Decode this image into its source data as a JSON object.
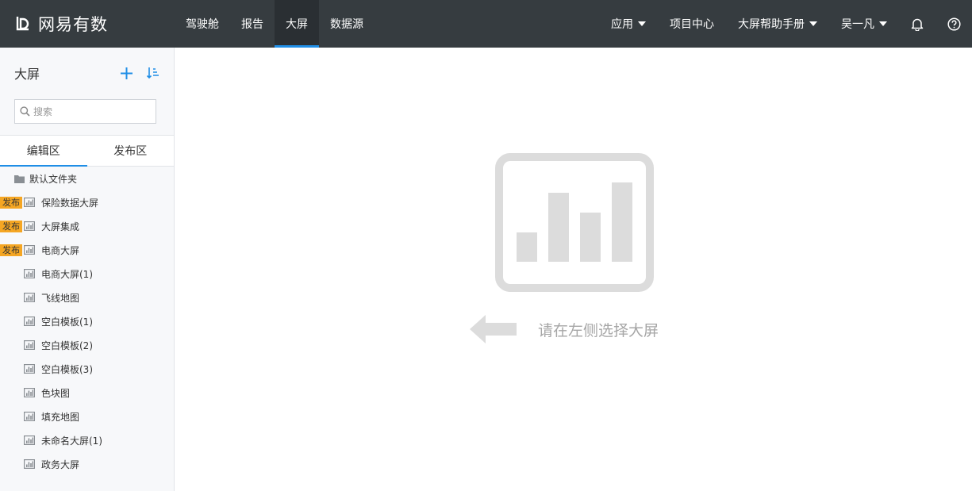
{
  "brand": {
    "name": "网易有数"
  },
  "nav": {
    "items": [
      {
        "label": "驾驶舱",
        "active": false
      },
      {
        "label": "报告",
        "active": false
      },
      {
        "label": "大屏",
        "active": true
      },
      {
        "label": "数据源",
        "active": false
      }
    ],
    "right": {
      "apps": "应用",
      "projects": "项目中心",
      "help": "大屏帮助手册",
      "user": "吴一凡"
    }
  },
  "sidebar": {
    "title": "大屏",
    "search_placeholder": "搜索",
    "tabs": [
      {
        "label": "编辑区",
        "active": true
      },
      {
        "label": "发布区",
        "active": false
      }
    ],
    "folder": {
      "label": "默认文件夹"
    },
    "publish_badge": "发布",
    "items": [
      {
        "label": "保险数据大屏",
        "published": true
      },
      {
        "label": "大屏集成",
        "published": true
      },
      {
        "label": "电商大屏",
        "published": true
      },
      {
        "label": "电商大屏(1)",
        "published": false
      },
      {
        "label": "飞线地图",
        "published": false
      },
      {
        "label": "空白模板(1)",
        "published": false
      },
      {
        "label": "空白模板(2)",
        "published": false
      },
      {
        "label": "空白模板(3)",
        "published": false
      },
      {
        "label": "色块图",
        "published": false
      },
      {
        "label": "填充地图",
        "published": false
      },
      {
        "label": "未命名大屏(1)",
        "published": false
      },
      {
        "label": "政务大屏",
        "published": false
      }
    ]
  },
  "main": {
    "empty_hint": "请在左侧选择大屏"
  },
  "colors": {
    "topbar": "#363c40",
    "accent": "#1f8ee6",
    "badge": "#f5a623",
    "empty_gray": "#dcdcdc"
  }
}
